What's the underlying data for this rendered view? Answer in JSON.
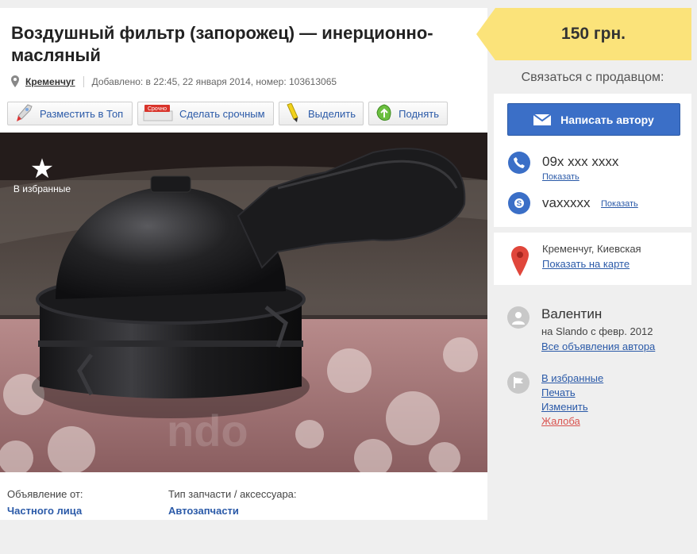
{
  "ad": {
    "title": "Воздушный фильтр (запорожец) — инерционно-масляный",
    "city": "Кременчуг",
    "added": "Добавлено: в 22:45, 22 января 2014, номер: 103613065"
  },
  "promo": [
    {
      "label": "Разместить в Топ",
      "icon": "rocket-icon"
    },
    {
      "label": "Сделать срочным",
      "icon": "urgent-badge-icon",
      "badge": "Срочно"
    },
    {
      "label": "Выделить",
      "icon": "highlighter-icon"
    },
    {
      "label": "Поднять",
      "icon": "leaf-up-icon"
    }
  ],
  "photo": {
    "favorite_label": "В избранные",
    "icon": "star-icon"
  },
  "params": [
    {
      "label": "Объявление от:",
      "value": "Частного лица"
    },
    {
      "label": "Тип запчасти / аксессуара:",
      "value": "Автозапчасти"
    }
  ],
  "price": "150 грн.",
  "contact": {
    "label": "Связаться с продавцом:",
    "write_button": "Написать автору",
    "phone": "09x xxx xxxx",
    "phone_show": "Показать",
    "skype": "vaxxxxx",
    "skype_show": "Показать"
  },
  "location": {
    "text": "Кременчуг, Киевская",
    "map_link": "Показать на карте"
  },
  "seller": {
    "name": "Валентин",
    "since": "на Slando с февр. 2012",
    "all_ads": "Все объявления автора"
  },
  "actions": {
    "favorite": "В избранные",
    "print": "Печать",
    "edit": "Изменить",
    "report": "Жалоба"
  },
  "colors": {
    "accent_blue": "#3b6fc7",
    "link": "#2b5aa8",
    "price_yellow": "#fbe37a",
    "report_red": "#d9534f"
  }
}
